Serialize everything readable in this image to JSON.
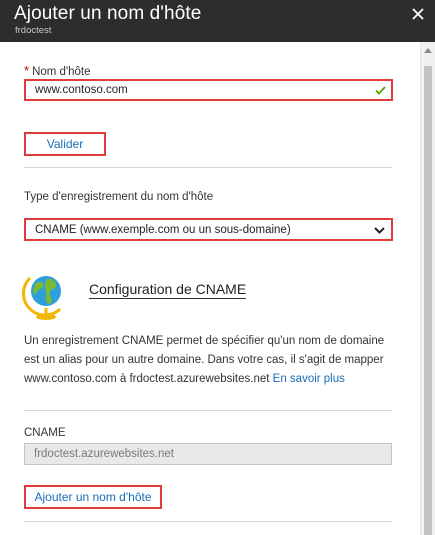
{
  "header": {
    "title": "Ajouter un nom d'hôte",
    "subtitle": "frdoctest"
  },
  "hostname": {
    "required_mark": "*",
    "label": "Nom d'hôte",
    "value": "www.contoso.com"
  },
  "validate_button": "Valider",
  "record_type": {
    "label": "Type d'enregistrement du nom d'hôte",
    "selected": "CNAME (www.exemple.com ou un sous-domaine)"
  },
  "cname_section": {
    "title": "Configuration de CNAME",
    "description": "Un enregistrement CNAME permet de spécifier qu'un nom de domaine est un alias pour un autre domaine. Dans votre cas, il s'agit de mapper www.contoso.com à frdoctest.azurewebsites.net",
    "learn_more": "En savoir plus"
  },
  "cname_field": {
    "label": "CNAME",
    "value": "frdoctest.azurewebsites.net"
  },
  "add_button": "Ajouter un nom d'hôte",
  "colors": {
    "header_bg": "#2d2d30",
    "highlight": "#e23b3b",
    "link": "#1a6db7",
    "check": "#57a300",
    "required": "#c40000"
  }
}
